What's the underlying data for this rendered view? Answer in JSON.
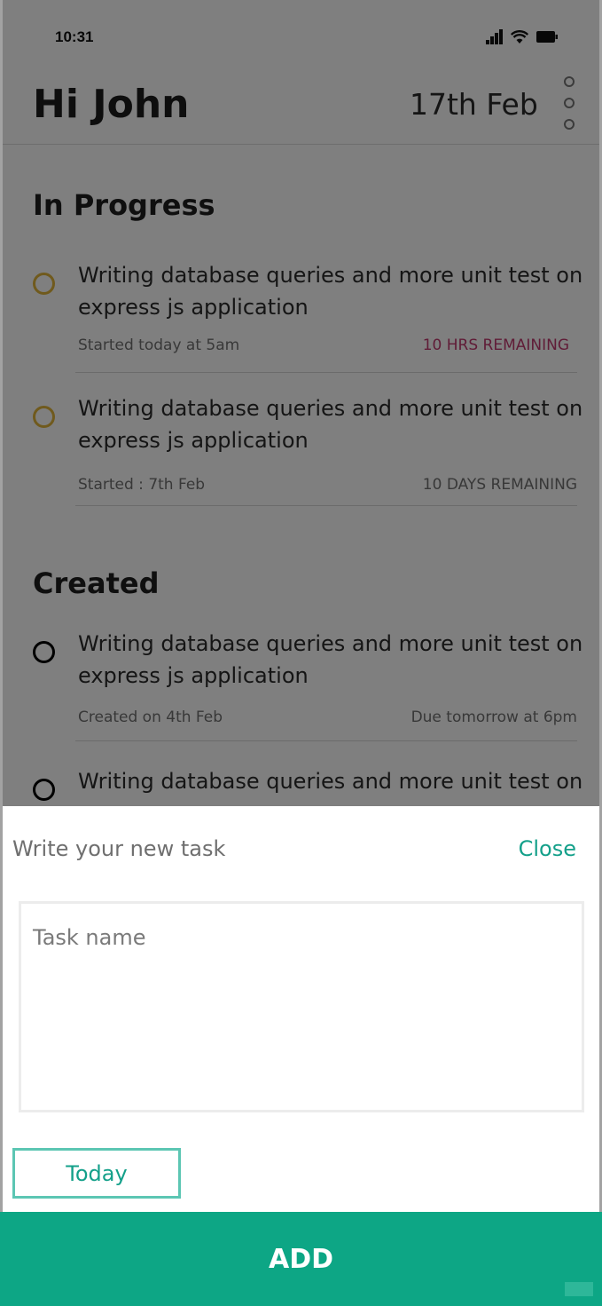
{
  "status_bar": {
    "time": "10:31",
    "icons": [
      "signal-icon",
      "wifi-icon",
      "battery-icon"
    ]
  },
  "header": {
    "greeting": "Hi John",
    "date": "17th Feb",
    "menu_icon": "kebab-menu-icon"
  },
  "sections": [
    {
      "title": "In Progress",
      "tasks": [
        {
          "title": "Writing database queries and more unit test on express js application",
          "meta": "Started today at 5am",
          "status": "10 HRS REMAINING",
          "status_color": "#c0396f",
          "circle_color": "#e0b43a"
        },
        {
          "title": "Writing database queries and more unit test on express js application",
          "meta": "Started : 7th Feb",
          "status": "10 DAYS REMAINING",
          "status_color": "#707070",
          "circle_color": "#e0b43a"
        }
      ]
    },
    {
      "title": "Created",
      "tasks": [
        {
          "title": "Writing database queries and more unit test on express js application",
          "meta": "Created on 4th Feb",
          "status": "Due tomorrow at 6pm",
          "status_color": "#707070",
          "circle_color": "#000000"
        },
        {
          "title": "Writing database queries and more unit test on",
          "circle_color": "#000000"
        }
      ]
    }
  ],
  "new_task_sheet": {
    "title": "Write your new task",
    "close_label": "Close",
    "input_placeholder": "Task name",
    "input_value": "",
    "date_button_label": "Today"
  },
  "add_button": {
    "label": "ADD"
  },
  "colors": {
    "accent": "#0da685",
    "accent_text": "#14a08a",
    "overlay": "rgba(0,0,0,0.5)"
  }
}
